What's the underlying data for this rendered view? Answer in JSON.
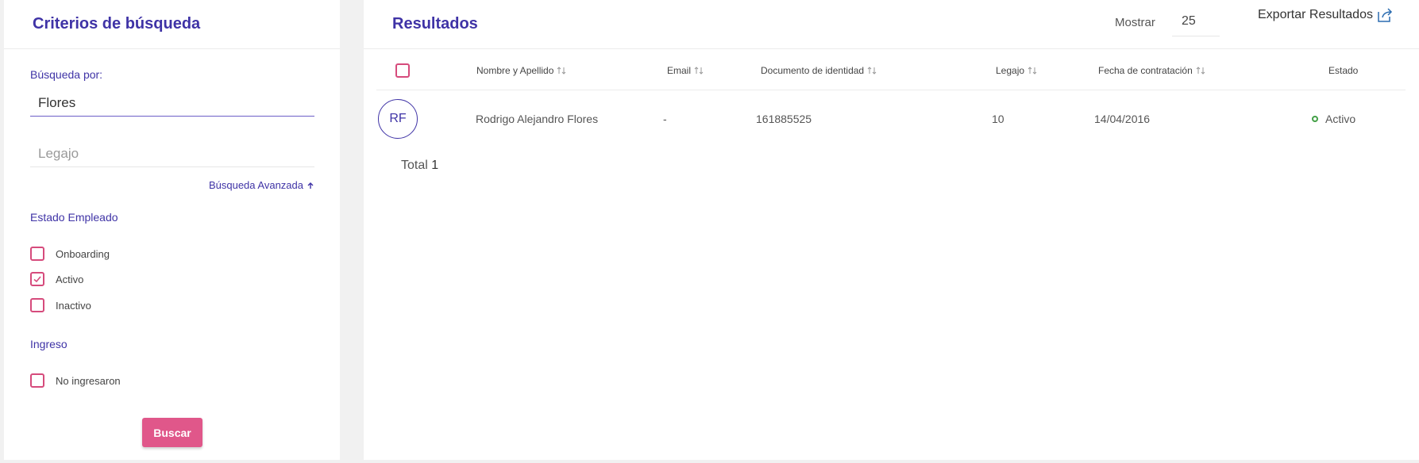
{
  "search_panel": {
    "title": "Criterios de búsqueda",
    "search_label": "Búsqueda por:",
    "search_value": "Flores",
    "legajo_placeholder": "Legajo",
    "advanced_link": "Búsqueda Avanzada",
    "estado_title": "Estado Empleado",
    "estado_options": [
      {
        "label": "Onboarding",
        "checked": false
      },
      {
        "label": "Activo",
        "checked": true
      },
      {
        "label": "Inactivo",
        "checked": false
      }
    ],
    "ingreso_title": "Ingreso",
    "ingreso_options": [
      {
        "label": "No ingresaron",
        "checked": false
      }
    ],
    "search_button": "Buscar"
  },
  "results_panel": {
    "title": "Resultados",
    "mostrar_label": "Mostrar",
    "mostrar_value": "25",
    "export_label": "Exportar Resultados",
    "columns": {
      "nombre": "Nombre y Apellido",
      "email": "Email",
      "documento": "Documento de identidad",
      "legajo": "Legajo",
      "fecha": "Fecha de contratación",
      "estado": "Estado"
    },
    "rows": [
      {
        "initials": "RF",
        "nombre": "Rodrigo Alejandro Flores",
        "email": "-",
        "documento": "161885525",
        "legajo": "10",
        "fecha": "14/04/2016",
        "estado": "Activo"
      }
    ],
    "total_label": "Total",
    "total_count": "1"
  },
  "colors": {
    "accent": "#3f33a6",
    "checkbox": "#d64b7c",
    "button": "#e0578a",
    "status_active": "#43a047"
  }
}
